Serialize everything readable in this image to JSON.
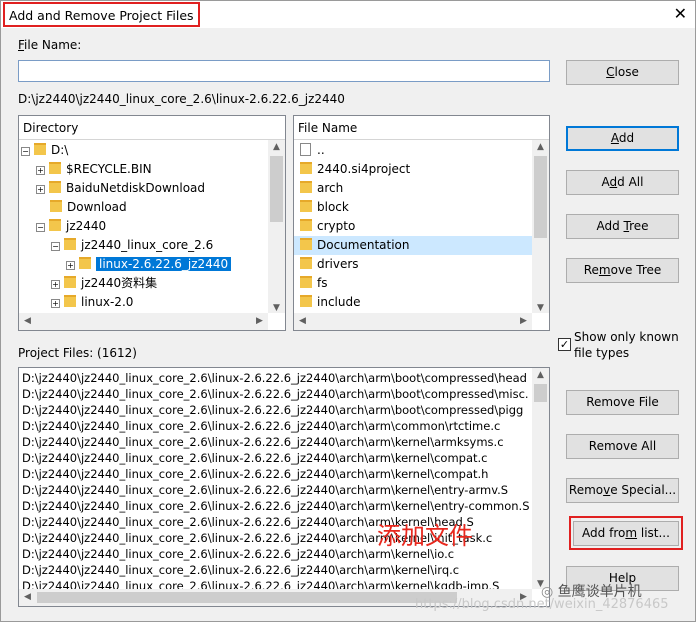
{
  "window": {
    "title": "Add and Remove Project Files",
    "close_glyph": "✕"
  },
  "file_name": {
    "label_u": "F",
    "label_rest": "ile Name:",
    "value": ""
  },
  "current_path": "D:\\jz2440\\jz2440_linux_core_2.6\\linux-2.6.22.6_jz2440",
  "directory_panel": {
    "header": "Directory",
    "items": [
      {
        "label": "D:\\",
        "expander": "⊟"
      },
      {
        "label": "$RECYCLE.BIN",
        "expander": "⊞"
      },
      {
        "label": "BaiduNetdiskDownload",
        "expander": "⊞"
      },
      {
        "label": "Download",
        "expander": ""
      },
      {
        "label": "jz2440",
        "expander": "⊟"
      },
      {
        "label": "jz2440_linux_core_2.6",
        "expander": "⊟"
      },
      {
        "label": "linux-2.6.22.6_jz2440",
        "expander": "⊞",
        "selected": true
      },
      {
        "label": "jz2440资料集",
        "expander": "⊞"
      },
      {
        "label": "linux-2.0",
        "expander": "⊞"
      }
    ]
  },
  "file_panel": {
    "header": "File Name",
    "items": [
      {
        "label": "..",
        "kind": "file"
      },
      {
        "label": "2440.si4project",
        "kind": "folder"
      },
      {
        "label": "arch",
        "kind": "folder"
      },
      {
        "label": "block",
        "kind": "folder"
      },
      {
        "label": "crypto",
        "kind": "folder"
      },
      {
        "label": "Documentation",
        "kind": "folder",
        "highlighted": true
      },
      {
        "label": "drivers",
        "kind": "folder"
      },
      {
        "label": "fs",
        "kind": "folder"
      },
      {
        "label": "include",
        "kind": "folder"
      }
    ]
  },
  "buttons": {
    "close": {
      "u": "C",
      "rest": "lose",
      "pre": ""
    },
    "add": {
      "pre": "",
      "u": "A",
      "rest": "dd"
    },
    "add_all": {
      "pre": "A",
      "u": "d",
      "rest": "d All"
    },
    "add_tree": {
      "pre": "Add ",
      "u": "T",
      "rest": "ree"
    },
    "remove_tree": {
      "pre": "Re",
      "u": "m",
      "rest": "ove Tree"
    },
    "remove_file": "Remove File",
    "remove_all": "Remove All",
    "remove_special": {
      "pre": "Remo",
      "u": "v",
      "rest": "e Special..."
    },
    "add_from_list": {
      "pre": "Add fro",
      "u": "m",
      "rest": " list..."
    },
    "help": "Help"
  },
  "show_known": {
    "label": "Show only known file types",
    "checked": true,
    "check_glyph": "✓"
  },
  "project_files": {
    "label": "Project Files: (1612)",
    "rows": [
      "D:\\jz2440\\jz2440_linux_core_2.6\\linux-2.6.22.6_jz2440\\arch\\arm\\boot\\compressed\\head",
      "D:\\jz2440\\jz2440_linux_core_2.6\\linux-2.6.22.6_jz2440\\arch\\arm\\boot\\compressed\\misc.",
      "D:\\jz2440\\jz2440_linux_core_2.6\\linux-2.6.22.6_jz2440\\arch\\arm\\boot\\compressed\\pigg",
      "D:\\jz2440\\jz2440_linux_core_2.6\\linux-2.6.22.6_jz2440\\arch\\arm\\common\\rtctime.c",
      "D:\\jz2440\\jz2440_linux_core_2.6\\linux-2.6.22.6_jz2440\\arch\\arm\\kernel\\armksyms.c",
      "D:\\jz2440\\jz2440_linux_core_2.6\\linux-2.6.22.6_jz2440\\arch\\arm\\kernel\\compat.c",
      "D:\\jz2440\\jz2440_linux_core_2.6\\linux-2.6.22.6_jz2440\\arch\\arm\\kernel\\compat.h",
      "D:\\jz2440\\jz2440_linux_core_2.6\\linux-2.6.22.6_jz2440\\arch\\arm\\kernel\\entry-armv.S",
      "D:\\jz2440\\jz2440_linux_core_2.6\\linux-2.6.22.6_jz2440\\arch\\arm\\kernel\\entry-common.S",
      "D:\\jz2440\\jz2440_linux_core_2.6\\linux-2.6.22.6_jz2440\\arch\\arm\\kernel\\head.S",
      "D:\\jz2440\\jz2440_linux_core_2.6\\linux-2.6.22.6_jz2440\\arch\\arm\\kernel\\init_task.c",
      "D:\\jz2440\\jz2440_linux_core_2.6\\linux-2.6.22.6_jz2440\\arch\\arm\\kernel\\io.c",
      "D:\\jz2440\\jz2440_linux_core_2.6\\linux-2.6.22.6_jz2440\\arch\\arm\\kernel\\irq.c",
      "D:\\jz2440\\jz2440_linux_core_2.6\\linux-2.6.22.6_jz2440\\arch\\arm\\kernel\\kgdb-imp.S"
    ]
  },
  "annotation": "添加文件",
  "watermark": {
    "brand": "鱼鹰谈单片机",
    "url": "https://blog.csdn.net/weixin_42876465"
  },
  "colors": {
    "highlight_red": "#e02020",
    "selection_blue": "#0078d7",
    "row_highlight": "#cce8ff"
  }
}
